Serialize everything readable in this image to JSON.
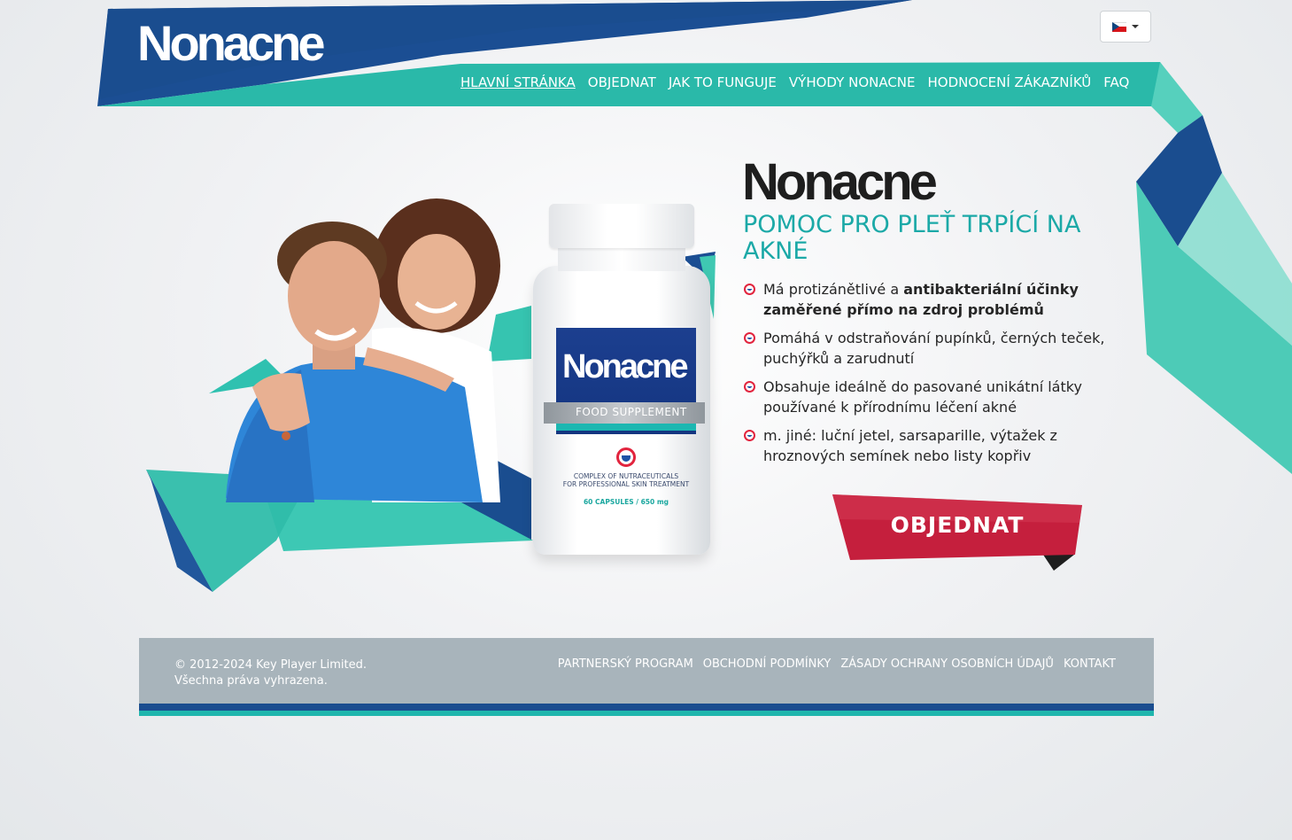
{
  "header": {
    "logo": "Nonacne",
    "nav": [
      {
        "label": "HLAVNÍ STRÁNKA",
        "active": true
      },
      {
        "label": "OBJEDNAT"
      },
      {
        "label": "JAK TO FUNGUJE"
      },
      {
        "label": "VÝHODY NONACNE"
      },
      {
        "label": "HODNOCENÍ ZÁKAZNÍKŮ"
      },
      {
        "label": "FAQ"
      }
    ],
    "language": {
      "flag_icon": "czech-flag-icon",
      "selected": "cs"
    }
  },
  "hero": {
    "product_logo": "Nonacne",
    "headline": "POMOC PRO PLEŤ TRPÍCÍ NA AKNÉ",
    "features": [
      {
        "text": "Má protizánětlivé a ",
        "bold": "antibakteriální účinky zaměřené přímo na zdroj problémů"
      },
      {
        "text": "Pomáhá v odstraňování pupínků, černých teček, puchýřků a zarudnutí",
        "bold": ""
      },
      {
        "text": "Obsahuje ideálně do pasované unikátní látky používané k přírodnímu léčení akné",
        "bold": ""
      },
      {
        "text": "m. jiné: luční jetel, sarsaparille, výtažek z hroznových semínek nebo listy kopřiv",
        "bold": ""
      }
    ],
    "order_button": "OBJEDNAT",
    "bottle": {
      "brand": "Nonacne",
      "band": "FOOD SUPPLEMENT",
      "desc_line1": "COMPLEX OF NUTRACEUTICALS",
      "desc_line2": "FOR PROFESSIONAL SKIN TREATMENT",
      "capsules": "60 CAPSULES / 650 mg"
    }
  },
  "footer": {
    "copyright_line1": "© 2012-2024 Key Player Limited.",
    "copyright_line2": "Všechna práva vyhrazena.",
    "links": [
      "PARTNERSKÝ PROGRAM",
      "OBCHODNÍ PODMÍNKY",
      "ZÁSADY OCHRANY OSOBNÍCH ÚDAJŮ",
      "KONTAKT"
    ]
  },
  "colors": {
    "navy": "#1a4d8f",
    "teal": "#2fc1b0",
    "headline": "#1ba9a7",
    "button_red": "#c8223f",
    "footer": "#a8b4bb"
  }
}
